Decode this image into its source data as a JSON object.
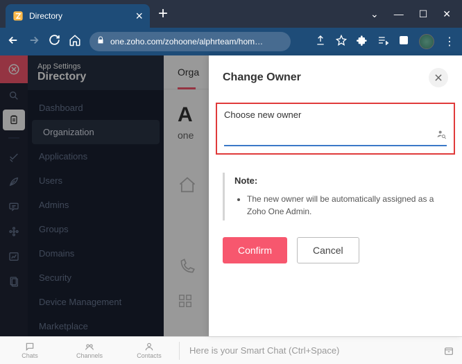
{
  "browser": {
    "tab_title": "Directory",
    "url": "one.zoho.com/zohoone/alphrteam/hom…"
  },
  "header": {
    "breadcrumb": "App Settings",
    "title": "Directory"
  },
  "sidebar": {
    "items": [
      {
        "label": "Dashboard"
      },
      {
        "label": "Organization"
      },
      {
        "label": "Applications"
      },
      {
        "label": "Users"
      },
      {
        "label": "Admins"
      },
      {
        "label": "Groups"
      },
      {
        "label": "Domains"
      },
      {
        "label": "Security"
      },
      {
        "label": "Device Management"
      },
      {
        "label": "Marketplace"
      }
    ]
  },
  "main": {
    "tab": "Orga",
    "title_cut": "A",
    "url_cut": "one"
  },
  "modal": {
    "title": "Change Owner",
    "input_label": "Choose new owner",
    "input_value": "",
    "note_title": "Note:",
    "note_item": "The new owner will be automatically assigned as a Zoho One Admin.",
    "confirm": "Confirm",
    "cancel": "Cancel"
  },
  "bottombar": {
    "tabs": [
      "Chats",
      "Channels",
      "Contacts"
    ],
    "placeholder": "Here is your Smart Chat (Ctrl+Space)"
  }
}
